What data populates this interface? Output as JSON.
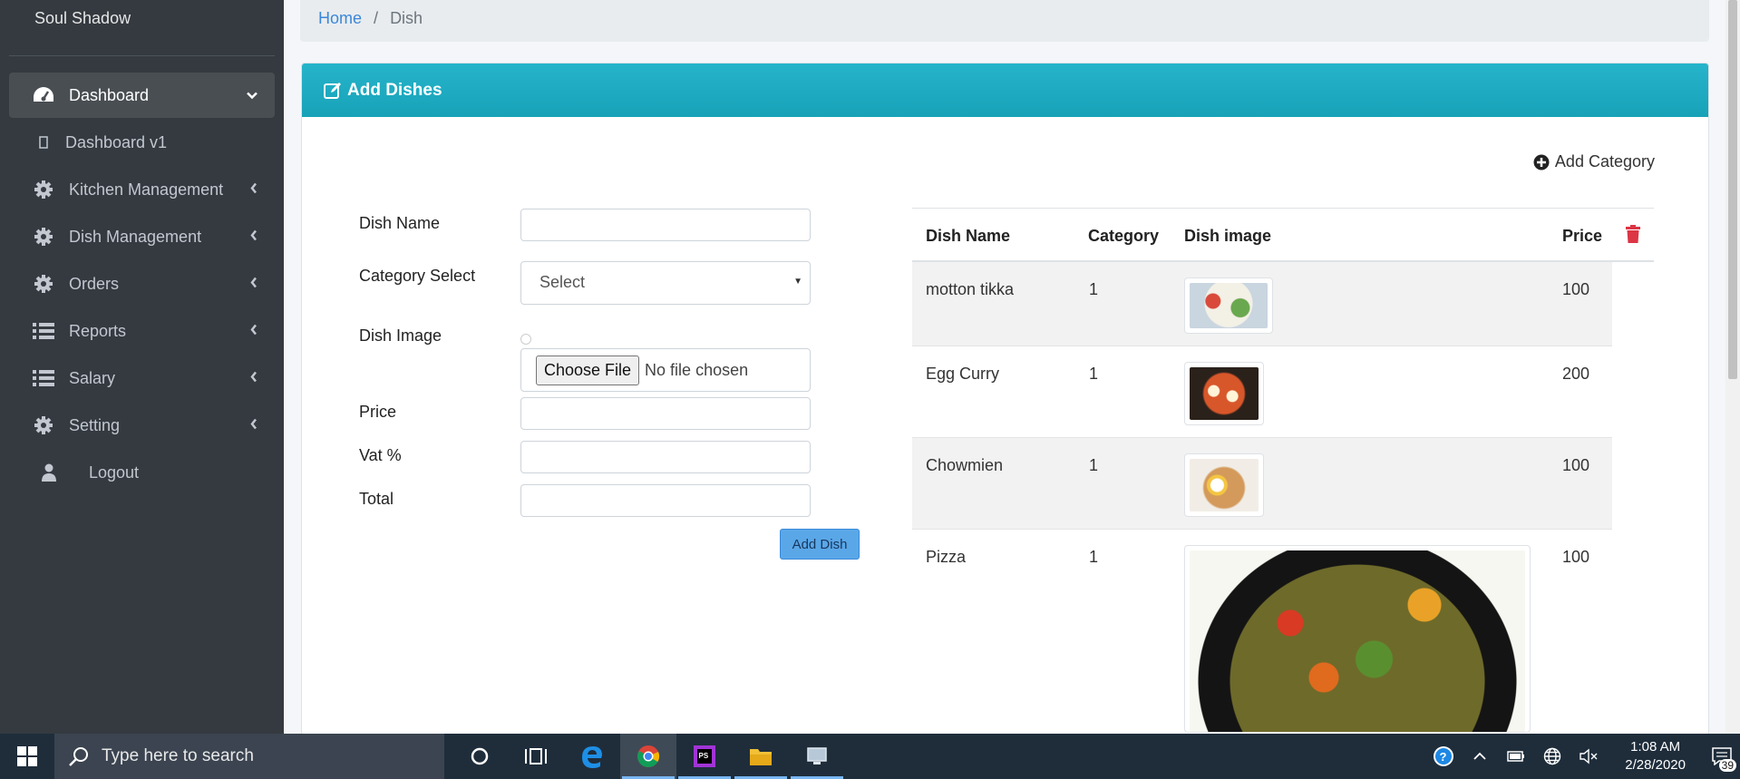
{
  "sidebar": {
    "brand": "Soul Shadow",
    "items": [
      {
        "label": "Dashboard",
        "icon": "tachometer-icon"
      },
      {
        "label": "Dashboard v1",
        "icon": "square-icon"
      },
      {
        "label": "Kitchen Management",
        "icon": "gear-icon"
      },
      {
        "label": "Dish Management",
        "icon": "gear-icon"
      },
      {
        "label": "Orders",
        "icon": "gear-icon"
      },
      {
        "label": "Reports",
        "icon": "list-icon"
      },
      {
        "label": "Salary",
        "icon": "list-icon"
      },
      {
        "label": "Setting",
        "icon": "gear-icon"
      },
      {
        "label": "Logout",
        "icon": "user-icon"
      }
    ]
  },
  "breadcrumb": {
    "home": "Home",
    "sep": "/",
    "current": "Dish"
  },
  "card": {
    "title": "Add Dishes",
    "add_category": "Add Category"
  },
  "form": {
    "dish_name_label": "Dish Name",
    "category_label": "Category Select",
    "category_value": "Select",
    "dish_image_label": "Dish Image",
    "choose_file": "Choose File",
    "no_file": "No file chosen",
    "price_label": "Price",
    "vat_label": "Vat %",
    "total_label": "Total",
    "submit": "Add Dish"
  },
  "table": {
    "headers": [
      "Dish Name",
      "Category",
      "Dish image",
      "Price"
    ],
    "rows": [
      {
        "name": "motton tikka",
        "category": "1",
        "price": "100"
      },
      {
        "name": "Egg Curry",
        "category": "1",
        "price": "200"
      },
      {
        "name": "Chowmien",
        "category": "1",
        "price": "100"
      },
      {
        "name": "Pizza",
        "category": "1",
        "price": "100"
      }
    ]
  },
  "taskbar": {
    "search_placeholder": "Type here to search",
    "time": "1:08 AM",
    "date": "2/28/2020",
    "notifications": "39"
  },
  "colors": {
    "header": "#17a2b8",
    "sidebar": "#343a40",
    "link": "#3a87d8",
    "delete": "#dc3545",
    "button": "#5aa7e8"
  }
}
